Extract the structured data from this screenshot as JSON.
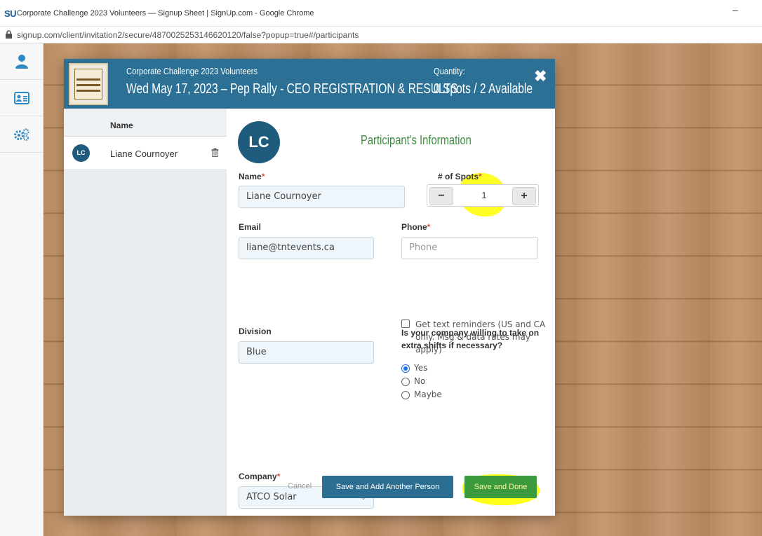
{
  "browser": {
    "logo_text": "SU",
    "window_title": "Corporate Challenge 2023 Volunteers — Signup Sheet | SignUp.com - Google Chrome",
    "minimize": "–",
    "url": "signup.com/client/invitation2/secure/4870025253146620120/false?popup=true#/participants"
  },
  "sidebar": {
    "items": [
      {
        "icon": "user-icon"
      },
      {
        "icon": "contact-card-icon"
      },
      {
        "icon": "gears-icon"
      }
    ]
  },
  "modal": {
    "title": "Corporate Challenge 2023 Volunteers",
    "subtitle": "Wed May 17, 2023 – Pep Rally - CEO REGISTRATION & RESULTS",
    "quantity_label": "Quantity:",
    "quantity_value": "0 Spots / 2 Available",
    "close_glyph": "✖"
  },
  "participants": {
    "header": "Name",
    "list": [
      {
        "initials": "LC",
        "name": "Liane Cournoyer"
      }
    ]
  },
  "form": {
    "avatar_initials": "LC",
    "section_title": "Participant's Information",
    "name_label": "Name",
    "name_value": "Liane Cournoyer",
    "spots_label": "# of Spots",
    "spots_value": "1",
    "minus": "−",
    "plus": "+",
    "email_label": "Email",
    "email_value": "liane@tntevents.ca",
    "phone_label": "Phone",
    "phone_placeholder": "Phone",
    "text_reminders": "Get text reminders (US and CA only. Msg & data rates may apply)",
    "division_label": "Division",
    "division_value": "Blue",
    "extra_shifts_question": "Is your company willing to take on extra shifts if necessary?",
    "radio_options": [
      "Yes",
      "No",
      "Maybe"
    ],
    "radio_selected": "Yes",
    "company_label": "Company",
    "company_value": "ATCO Solar",
    "required_mark": "*",
    "cancel": "Cancel",
    "save_add": "Save and Add Another Person",
    "save_done": "Save and Done"
  }
}
